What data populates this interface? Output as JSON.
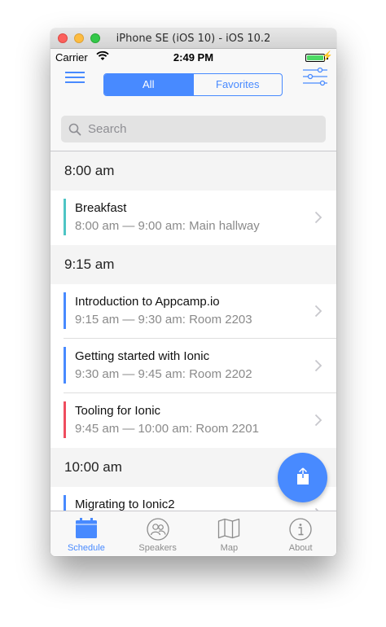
{
  "window": {
    "title": "iPhone SE (iOS 10) - iOS 10.2"
  },
  "status_bar": {
    "carrier": "Carrier",
    "time": "2:49 PM",
    "battery_level": 1.0,
    "charging": true
  },
  "header": {
    "segments": [
      {
        "label": "All",
        "selected": true
      },
      {
        "label": "Favorites",
        "selected": false
      }
    ],
    "menu_icon": "menu-icon",
    "filter_icon": "options-icon"
  },
  "search": {
    "placeholder": "Search"
  },
  "schedule": [
    {
      "time": "8:00 am",
      "sessions": [
        {
          "name": "Breakfast",
          "detail": "8:00 am — 9:00 am: Main hallway",
          "track_color": "#4ec5c5"
        }
      ]
    },
    {
      "time": "9:15 am",
      "sessions": [
        {
          "name": "Introduction to Appcamp.io",
          "detail": "9:15 am — 9:30 am: Room 2203",
          "track_color": "#488aff"
        },
        {
          "name": "Getting started with Ionic",
          "detail": "9:30 am — 9:45 am: Room 2202",
          "track_color": "#488aff"
        },
        {
          "name": "Tooling for Ionic",
          "detail": "9:45 am — 10:00 am: Room 2201",
          "track_color": "#ef4d5e"
        }
      ]
    },
    {
      "time": "10:00 am",
      "sessions": [
        {
          "name": "Migrating to Ionic2",
          "detail": "",
          "track_color": "#488aff"
        }
      ]
    }
  ],
  "fab": {
    "icon": "share-icon"
  },
  "tabs": [
    {
      "label": "Schedule",
      "icon": "calendar-icon",
      "active": true
    },
    {
      "label": "Speakers",
      "icon": "contacts-icon",
      "active": false
    },
    {
      "label": "Map",
      "icon": "map-icon",
      "active": false
    },
    {
      "label": "About",
      "icon": "info-icon",
      "active": false
    }
  ],
  "colors": {
    "accent": "#488aff",
    "divider_bg": "#f4f4f4",
    "battery": "#4cd964"
  }
}
